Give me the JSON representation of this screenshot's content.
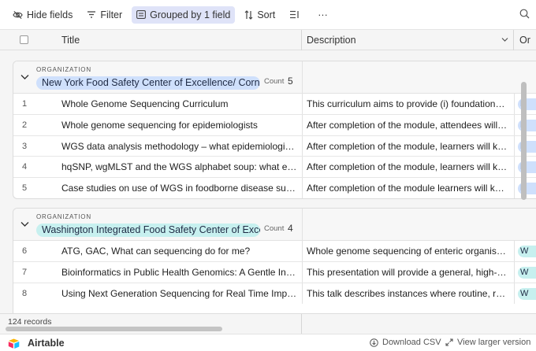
{
  "toolbar": {
    "hide_fields": "Hide fields",
    "filter": "Filter",
    "grouped": "Grouped by 1 field",
    "sort": "Sort",
    "more": "···"
  },
  "columns": {
    "title": "Title",
    "description": "Description",
    "organization": "Or"
  },
  "groups": [
    {
      "label": "ORGANIZATION",
      "value": "New York Food Safety Center of Excellence/ Cornell",
      "count_label": "Count",
      "count": "5",
      "color": "#cfe0fc",
      "rows": [
        {
          "num": "1",
          "title": "Whole Genome Sequencing Curriculum",
          "desc": "This curriculum aims to provide (i) foundational k...",
          "chip": "N"
        },
        {
          "num": "2",
          "title": "Whole genome sequencing for epidemiologists",
          "desc": "After completion of the module, attendees will kn...",
          "chip": "N"
        },
        {
          "num": "3",
          "title": "WGS data analysis methodology – what epidemiologists ...",
          "desc": "After completion of the module, learners will know:",
          "chip": "N"
        },
        {
          "num": "4",
          "title": "hqSNP, wgMLST and the WGS alphabet soup: what epide...",
          "desc": "After completion of the module, learners will know:",
          "chip": "N"
        },
        {
          "num": "5",
          "title": "Case studies on use of WGS in foodborne disease surveill...",
          "desc": "After completion of the module learners will know:",
          "chip": "N"
        }
      ]
    },
    {
      "label": "ORGANIZATION",
      "value": "Washington Integrated Food Safety Center of Excellence",
      "count_label": "Count",
      "count": "4",
      "color": "#c7f0ef",
      "rows": [
        {
          "num": "6",
          "title": "ATG, GAC, What can sequencing do for me?",
          "desc": "Whole genome sequencing of enteric organisms ...",
          "chip": "W"
        },
        {
          "num": "7",
          "title": "Bioinformatics in Public Health Genomics: A Gentle Introd...",
          "desc": "This presentation will provide a general, high-lev...",
          "chip": "W"
        },
        {
          "num": "8",
          "title": "Using Next Generation Sequencing for Real Time Impact ...",
          "desc": "This talk describes instances where routine, rapi...",
          "chip": "W"
        }
      ]
    }
  ],
  "footer": {
    "records": "124 records"
  },
  "branding": {
    "logo": "Airtable",
    "download": "Download CSV",
    "view_larger": "View larger version"
  }
}
